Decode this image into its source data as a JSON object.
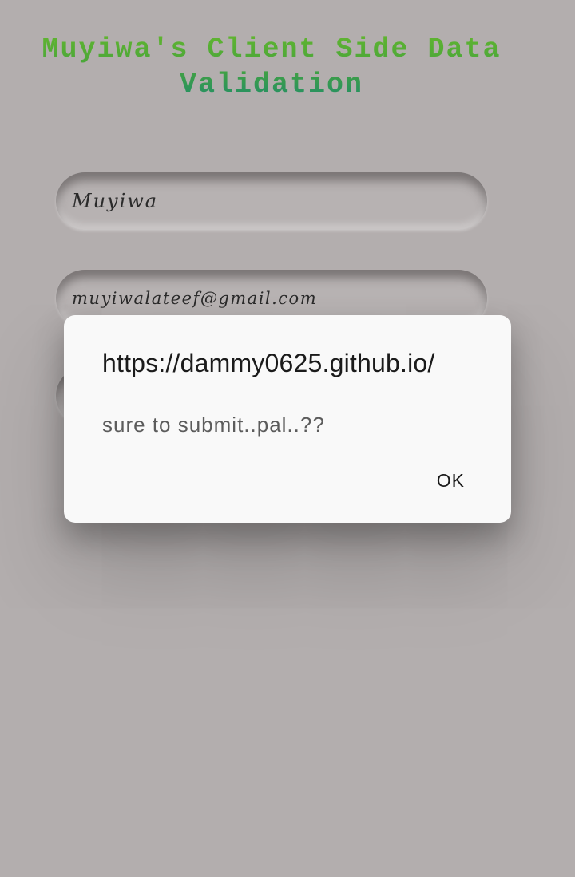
{
  "page": {
    "title": "Muyiwa's Client Side Data Validation",
    "form": {
      "name_value": "Muyiwa",
      "email_value": "muyiwalateef@gmail.com",
      "third_value": ""
    }
  },
  "dialog": {
    "origin": "https://dammy0625.github.io/",
    "message": "sure to submit..pal..??",
    "ok_label": "OK"
  }
}
